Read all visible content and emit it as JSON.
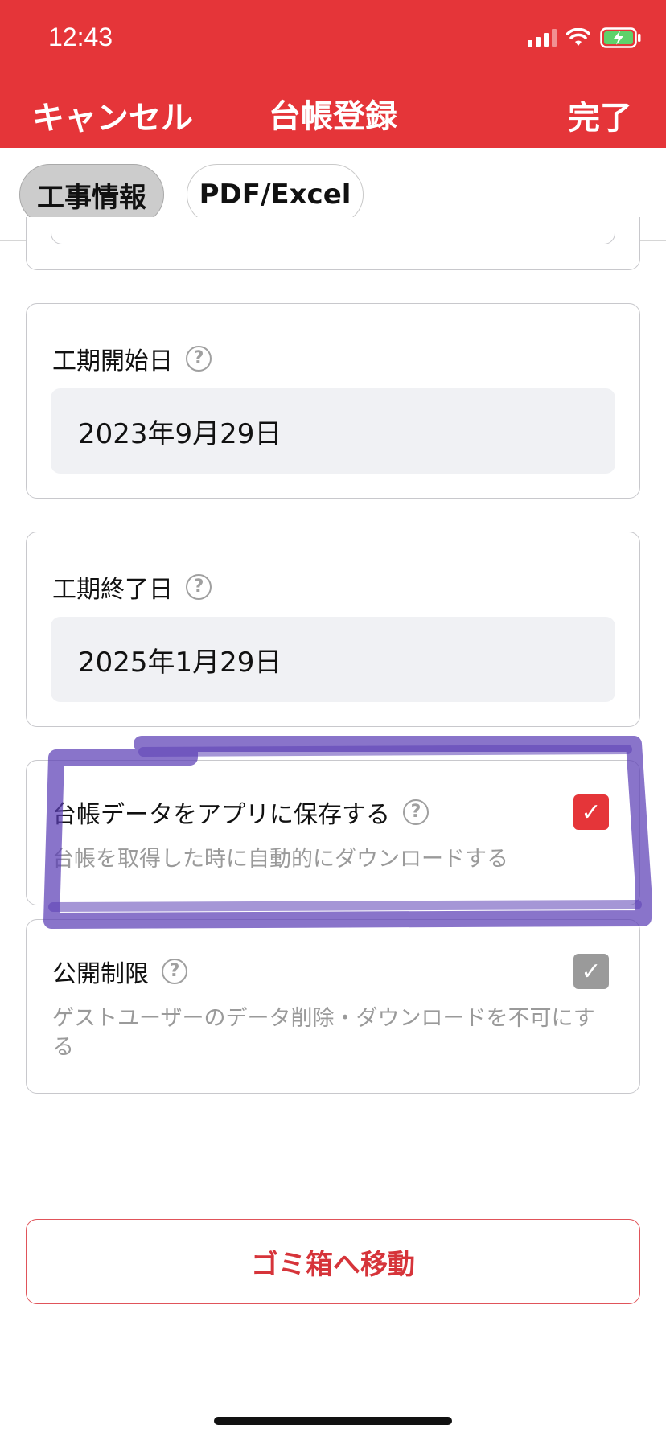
{
  "status_bar": {
    "time": "12:43",
    "icons": [
      "signal-icon",
      "wifi-icon",
      "battery-charging-icon"
    ]
  },
  "nav": {
    "cancel_label": "キャンセル",
    "title": "台帳登録",
    "done_label": "完了"
  },
  "tabs": [
    {
      "label": "工事情報",
      "active": true
    },
    {
      "label": "PDF/Excel",
      "active": false
    }
  ],
  "fields": {
    "start_date": {
      "label": "工期開始日",
      "value": "2023年9月29日"
    },
    "end_date": {
      "label": "工期終了日",
      "value": "2025年1月29日"
    }
  },
  "toggles": {
    "save_to_app": {
      "label": "台帳データをアプリに保存する",
      "description": "台帳を取得した時に自動的にダウンロードする",
      "checked": true
    },
    "public_restriction": {
      "label": "公開制限",
      "description": "ゲストユーザーのデータ削除・ダウンロードを不可にする",
      "checked": true
    }
  },
  "trash_button_label": "ゴミ箱へ移動",
  "help_glyph": "?",
  "check_glyph": "✓",
  "colors": {
    "brand_red": "#e53539",
    "annotation_purple": "#5b3fb5",
    "date_box_bg": "#f0f1f4",
    "checkbox_gray": "#9a9a9a"
  }
}
